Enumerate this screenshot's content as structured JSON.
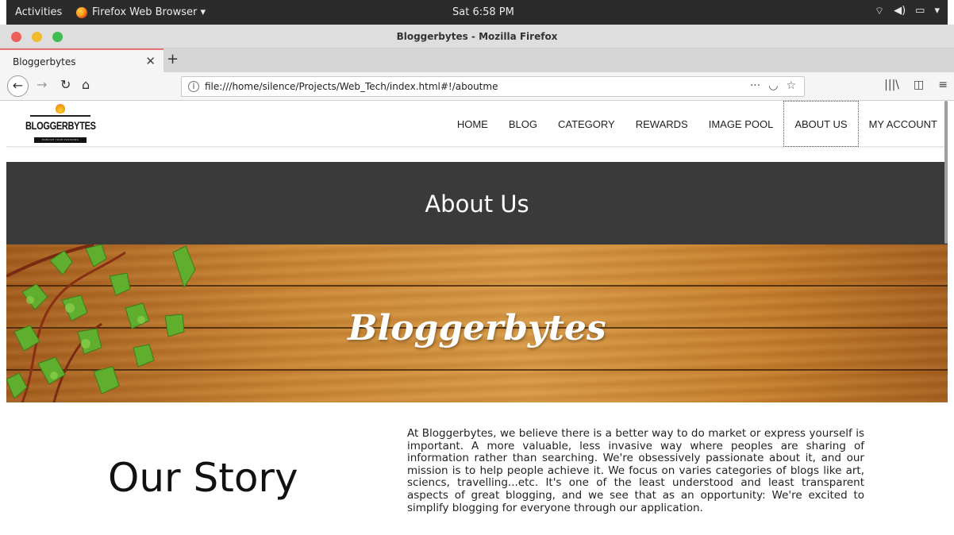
{
  "system_bar": {
    "activities": "Activities",
    "app_menu": "Firefox Web Browser ▾",
    "clock": "Sat  6:58 PM",
    "tray": [
      "wifi-icon",
      "volume-icon",
      "battery-icon",
      "system-menu-icon"
    ]
  },
  "window": {
    "title": "Bloggerbytes - Mozilla Firefox"
  },
  "tabs": [
    {
      "label": "Bloggerbytes",
      "active": true
    }
  ],
  "address_bar": {
    "url": "file:///home/silence/Projects/Web_Tech/index.html#!/aboutme"
  },
  "site": {
    "logo": {
      "wordmark": "BLOGGERBYTES",
      "tagline": "PUBLISH YOUR PASSIONS"
    },
    "menu": [
      {
        "label": "HOME",
        "active": false
      },
      {
        "label": "BLOG",
        "active": false
      },
      {
        "label": "CATEGORY",
        "active": false
      },
      {
        "label": "REWARDS",
        "active": false
      },
      {
        "label": "IMAGE POOL",
        "active": false
      },
      {
        "label": "ABOUT US",
        "active": true
      },
      {
        "label": "MY ACCOUNT",
        "active": false
      }
    ],
    "hero_title": "About Us",
    "banner_title": "Bloggerbytes",
    "story": {
      "heading": "Our Story",
      "body": "At Bloggerbytes, we believe there is a better way to do market or express yourself is important. A more valuable, less invasive way where peoples are sharing of information rather than searching. We're obsessively passionate about it, and our mission is to help people achieve it. We focus on varies categories of blogs like art, sciencs, travelling...etc. It's one of the least understood and least transparent aspects of great blogging, and we see that as an opportunity: We're excited to simplify blogging for everyone through our application."
    }
  },
  "colors": {
    "hero_bg": "#3a3a3a",
    "topbar_bg": "#2b2b2b",
    "tab_accent": "#e57373",
    "close_dot": "#ec5f5a",
    "minimize_dot": "#f1bd2f",
    "maximize_dot": "#3fbd52"
  }
}
